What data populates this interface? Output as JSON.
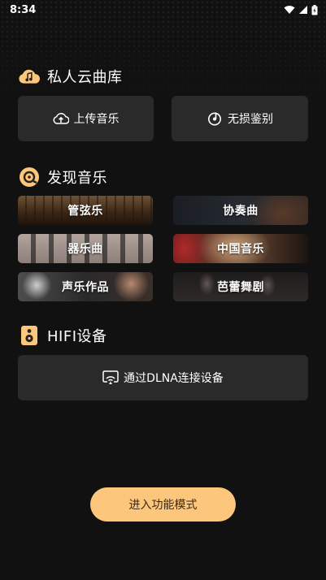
{
  "status_bar": {
    "time": "8:34"
  },
  "sections": {
    "cloud_library": {
      "title": "私人云曲库",
      "buttons": {
        "upload": "上传音乐",
        "lossless": "无损鉴别"
      }
    },
    "discover": {
      "title": "发现音乐",
      "categories": [
        "管弦乐",
        "协奏曲",
        "器乐曲",
        "中国音乐",
        "声乐作品",
        "芭蕾舞剧"
      ]
    },
    "hifi": {
      "title": "HIFI设备",
      "dlna_button": "通过DLNA连接设备"
    }
  },
  "cta": {
    "label": "进入功能模式"
  },
  "colors": {
    "accent": "#fcc67c",
    "card_bg": "#2a2a2a",
    "page_bg": "#111111"
  },
  "icons": [
    "cloud-music-icon",
    "upload-cloud-icon",
    "lossless-disc-icon",
    "discover-music-icon",
    "speaker-icon",
    "cast-screen-icon"
  ]
}
